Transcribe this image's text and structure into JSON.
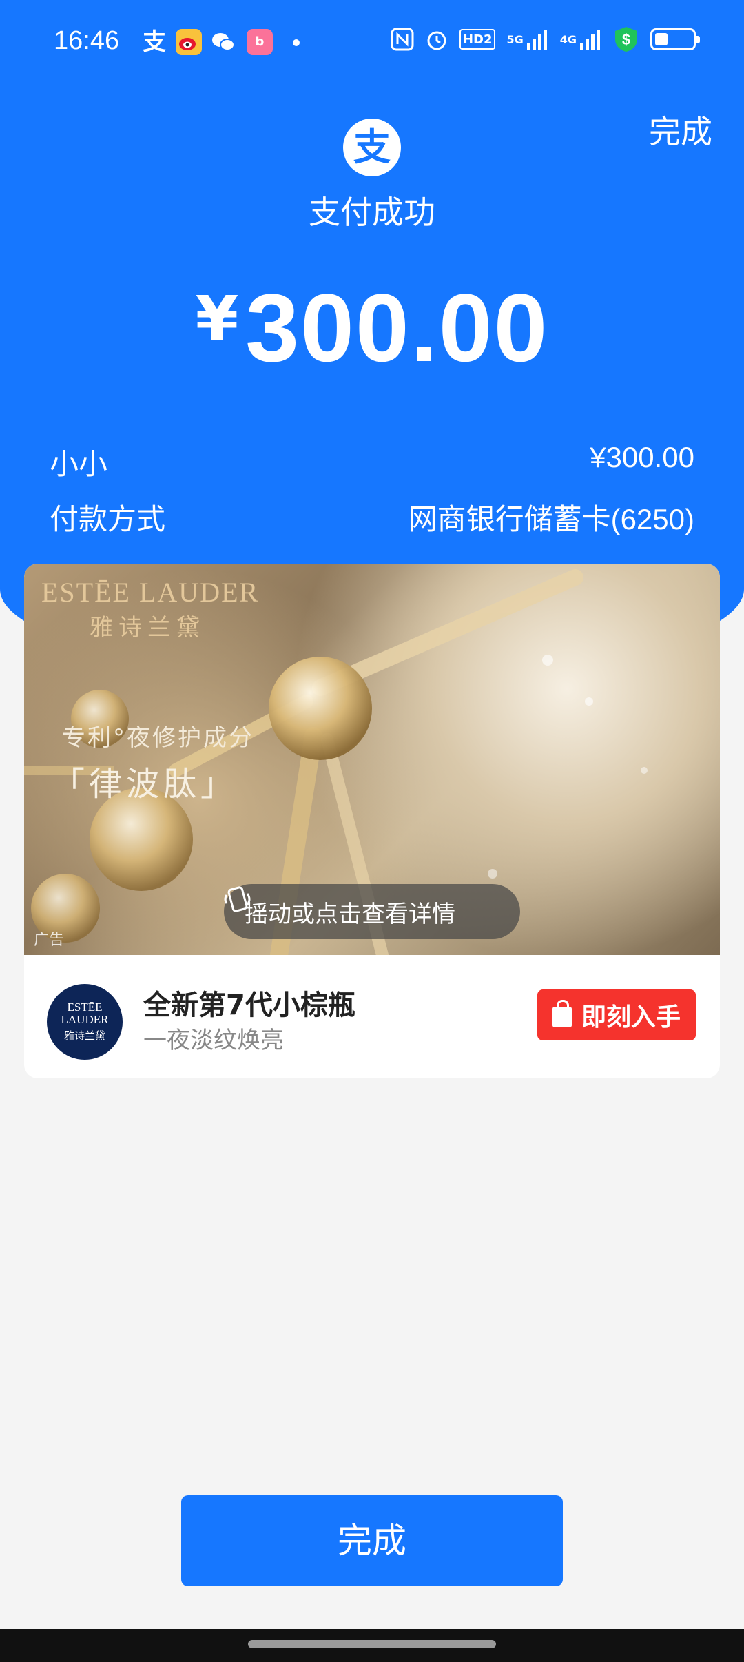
{
  "status_bar": {
    "time": "16:46",
    "apps": [
      {
        "name": "alipay-app-icon",
        "glyph": "支"
      },
      {
        "name": "weibo-app-icon",
        "glyph": "微"
      },
      {
        "name": "wechat-app-icon",
        "glyph": "信"
      },
      {
        "name": "bilibili-app-icon",
        "glyph": "b"
      }
    ],
    "network_labels": {
      "hd": "HD2",
      "g5": "5G",
      "g4": "4G"
    },
    "battery_level": 0.35
  },
  "header": {
    "done_label": "完成",
    "logo_glyph": "支",
    "status": "支付成功"
  },
  "payment": {
    "currency": "¥",
    "amount": "300.00"
  },
  "details": [
    {
      "label": "小小",
      "value": "¥300.00"
    },
    {
      "label": "付款方式",
      "value": "网商银行储蓄卡(6250)"
    }
  ],
  "ad": {
    "brand_en": "ESTĒE LAUDER",
    "brand_cn": "雅诗兰黛",
    "patent_text": "专利°夜修护成分",
    "bracket_text": "「律波肽」",
    "ad_tag": "广告",
    "shake_hint": "摇动或点击查看详情",
    "logo_line1": "ESTĒE",
    "logo_line2": "LAUDER",
    "logo_line3": "雅诗兰黛",
    "product_title": "全新第7代小棕瓶",
    "product_subtitle": "一夜淡纹焕亮",
    "buy_label": "即刻入手"
  },
  "footer": {
    "done_label": "完成"
  },
  "colors": {
    "primary": "#1677ff",
    "buy_button": "#f5332d",
    "page_bg": "#f4f4f4"
  }
}
